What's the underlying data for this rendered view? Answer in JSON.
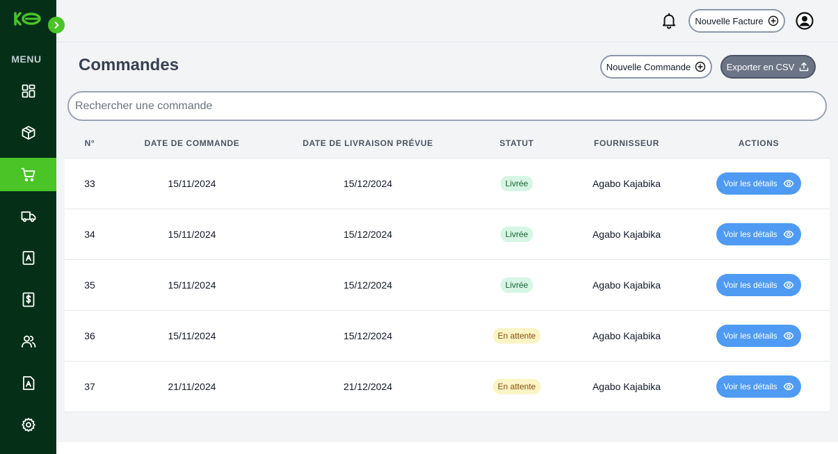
{
  "sidebar": {
    "menu_label": "MENU",
    "items": [
      {
        "icon": "dashboard-icon",
        "active": false
      },
      {
        "icon": "box-icon",
        "active": false
      },
      {
        "icon": "cart-icon",
        "active": true
      },
      {
        "icon": "truck-icon",
        "active": false
      },
      {
        "icon": "contact-book-icon",
        "active": false
      },
      {
        "icon": "invoice-dollar-icon",
        "active": false
      },
      {
        "icon": "users-icon",
        "active": false
      },
      {
        "icon": "document-icon",
        "active": false
      },
      {
        "icon": "gear-icon",
        "active": false
      }
    ]
  },
  "header": {
    "new_invoice_label": "Nouvelle Facture"
  },
  "page": {
    "title": "Commandes",
    "new_order_label": "Nouvelle Commande",
    "export_label": "Exporter en CSV",
    "search_placeholder": "Rechercher une commande",
    "search_value": ""
  },
  "table": {
    "headers": [
      "N°",
      "DATE DE COMMANDE",
      "DATE DE LIVRAISON PRÉVUE",
      "STATUT",
      "FOURNISSEUR",
      "ACTIONS"
    ],
    "rows": [
      {
        "no": "33",
        "order_date": "15/11/2024",
        "delivery_date": "15/12/2024",
        "status": "Livrée",
        "status_kind": "delivered",
        "supplier": "Agabo Kajabika",
        "action": "Voir les détails"
      },
      {
        "no": "34",
        "order_date": "15/11/2024",
        "delivery_date": "15/12/2024",
        "status": "Livrée",
        "status_kind": "delivered",
        "supplier": "Agabo Kajabika",
        "action": "Voir les détails"
      },
      {
        "no": "35",
        "order_date": "15/11/2024",
        "delivery_date": "15/12/2024",
        "status": "Livrée",
        "status_kind": "delivered",
        "supplier": "Agabo Kajabika",
        "action": "Voir les détails"
      },
      {
        "no": "36",
        "order_date": "15/11/2024",
        "delivery_date": "15/12/2024",
        "status": "En attente",
        "status_kind": "pending",
        "supplier": "Agabo Kajabika",
        "action": "Voir les détails"
      },
      {
        "no": "37",
        "order_date": "21/11/2024",
        "delivery_date": "21/12/2024",
        "status": "En attente",
        "status_kind": "pending",
        "supplier": "Agabo Kajabika",
        "action": "Voir les détails"
      }
    ]
  },
  "colors": {
    "sidebar_bg": "#053017",
    "accent_green": "#4ac426",
    "details_button": "#4f9bf3",
    "delivered_badge": "#d6f5e4",
    "pending_badge": "#fbf4c4"
  }
}
